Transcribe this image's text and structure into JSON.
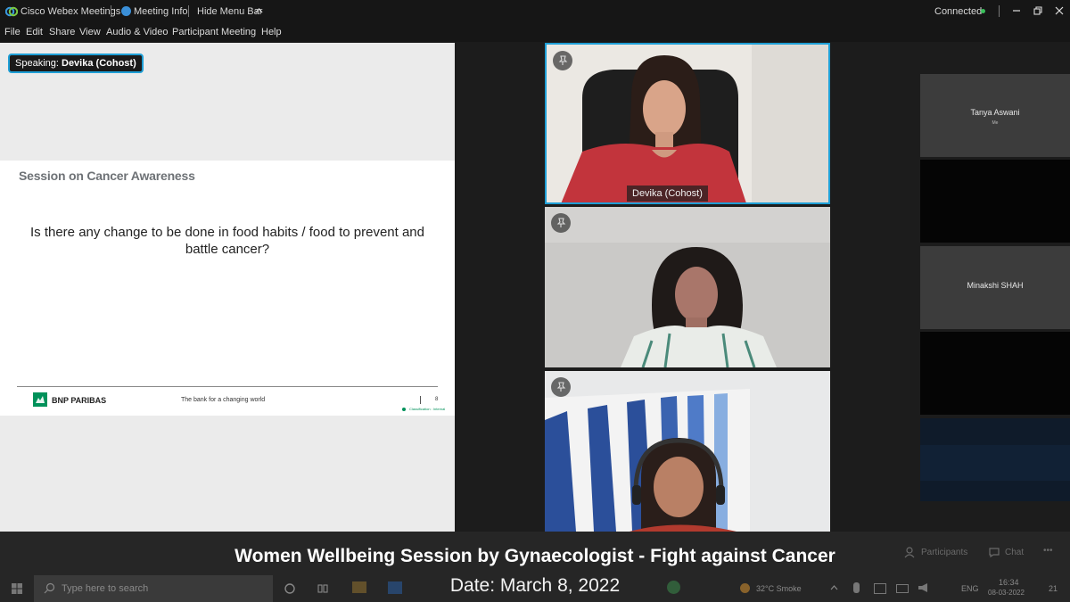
{
  "titlebar": {
    "app": "Cisco Webex Meetings",
    "meeting_info": "Meeting Info",
    "hide_menu": "Hide Menu Bar",
    "status": "Connected"
  },
  "menu": [
    "File",
    "Edit",
    "Share",
    "View",
    "Audio & Video",
    "Participant",
    "Meeting",
    "Help"
  ],
  "share": {
    "speaking_label": "Speaking:",
    "speaking_name": "Devika (Cohost)",
    "slide_title": "Session on Cancer Awareness",
    "slide_question": "Is there any change to be done in food habits / food to prevent and battle cancer?",
    "footer_brand": "BNP PARIBAS",
    "footer_tagline": "The bank for a changing world",
    "footer_page": "8",
    "footer_classification": "Classification : Internal"
  },
  "videos": [
    {
      "name": "Devika (Cohost)"
    },
    {
      "name": ""
    },
    {
      "name": ""
    }
  ],
  "participants": [
    {
      "name": "Tanya Aswani",
      "sub": "Me"
    },
    {
      "name": "Minakshi SHAH",
      "sub": ""
    }
  ],
  "controls": {
    "participants": "Participants",
    "chat": "Chat"
  },
  "caption": {
    "title": "Women Wellbeing Session by Gynaecologist - Fight against Cancer",
    "date": "Date: March 8, 2022"
  },
  "taskbar": {
    "search_placeholder": "Type here to search",
    "weather": "32°C  Smoke",
    "lang": "ENG",
    "time": "16:34",
    "date": "08-03-2022",
    "notif": "21"
  },
  "colors": {
    "accent": "#1e9fd6",
    "bnp_green": "#00915a",
    "connected": "#39c05a"
  }
}
